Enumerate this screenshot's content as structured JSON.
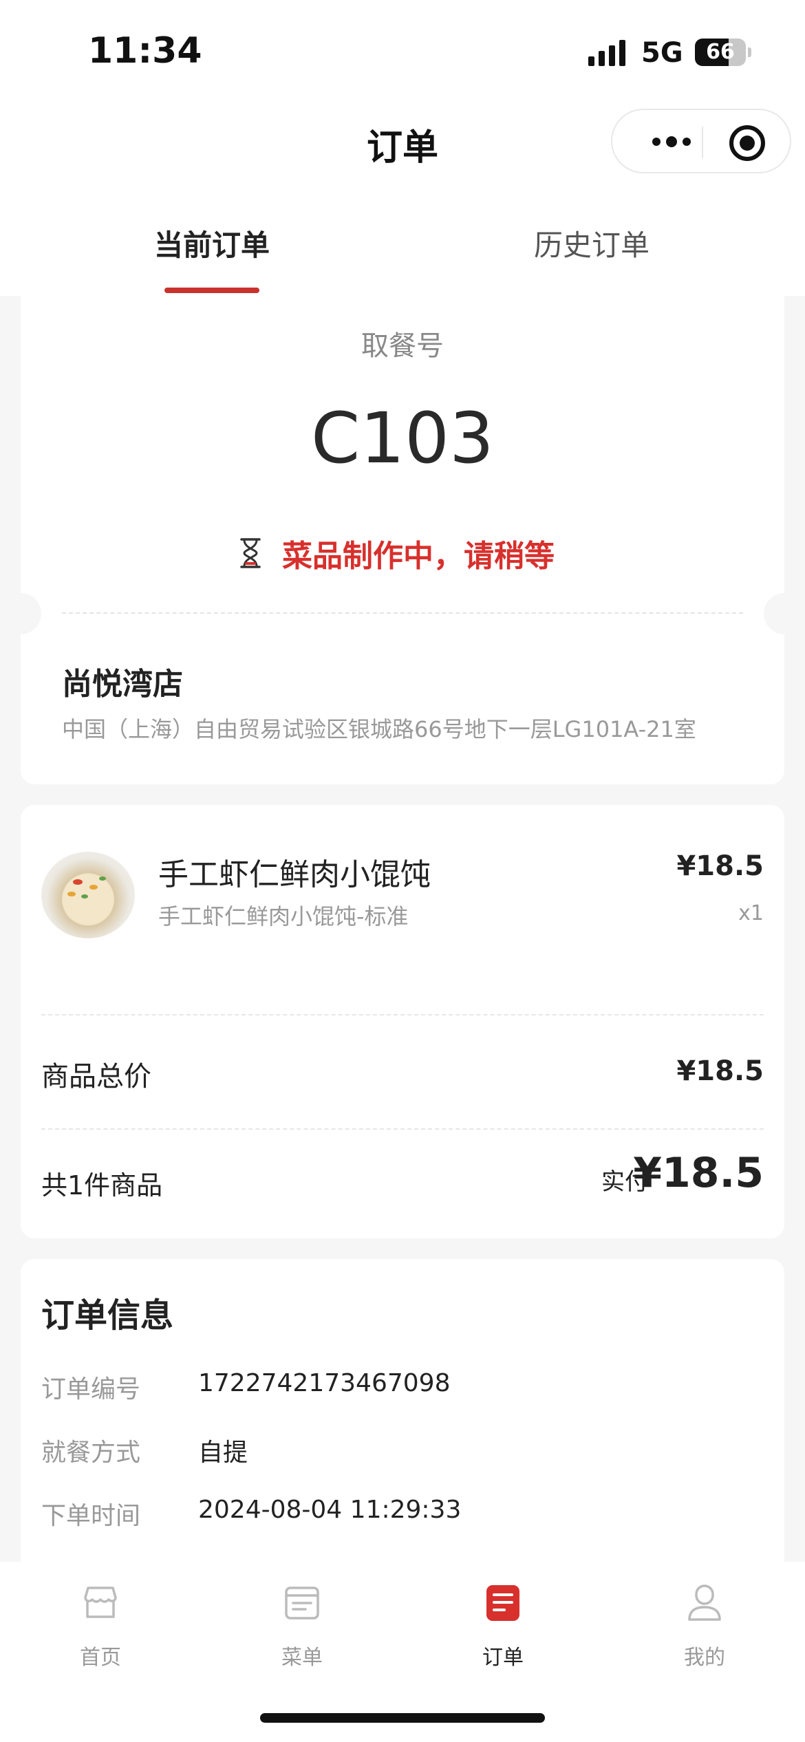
{
  "status_bar": {
    "time": "11:34",
    "network": "5G",
    "battery": "66",
    "battery_level": 0.66
  },
  "nav": {
    "title": "订单",
    "more_icon": "more-dots-icon",
    "close_icon": "target-circle-icon"
  },
  "tabs": [
    {
      "label": "当前订单",
      "active": true
    },
    {
      "label": "历史订单",
      "active": false
    }
  ],
  "pickup": {
    "label": "取餐号",
    "code": "C103",
    "status_icon": "hourglass-icon",
    "status_text": "菜品制作中，请稍等"
  },
  "store": {
    "name": "尚悦湾店",
    "address": "中国（上海）自由贸易试验区银城路66号地下一层LG101A-21室"
  },
  "items": [
    {
      "name": "手工虾仁鲜肉小馄饨",
      "spec": "手工虾仁鲜肉小馄饨-标准",
      "price": "¥18.5",
      "qty": "x1"
    }
  ],
  "summary": {
    "subtotal_label": "商品总价",
    "subtotal": "¥18.5",
    "count_label": "共1件商品",
    "paid_label": "实付",
    "paid": "¥18.5"
  },
  "order_info": {
    "title": "订单信息",
    "rows": [
      {
        "label": "订单编号",
        "value": "1722742173467098"
      },
      {
        "label": "就餐方式",
        "value": "自提"
      },
      {
        "label": "下单时间",
        "value": "2024-08-04 11:29:33"
      }
    ]
  },
  "tabbar": [
    {
      "label": "首页",
      "icon": "store-icon",
      "active": false
    },
    {
      "label": "菜单",
      "icon": "menu-card-icon",
      "active": false
    },
    {
      "label": "订单",
      "icon": "order-list-icon",
      "active": true
    },
    {
      "label": "我的",
      "icon": "user-icon",
      "active": false
    }
  ],
  "colors": {
    "accent": "#d7302d",
    "indicator": "#c8312c",
    "background": "#f6f6f6"
  }
}
